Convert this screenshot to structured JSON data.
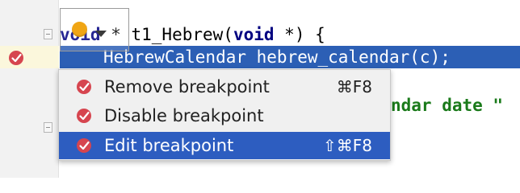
{
  "editor": {
    "line_1": {
      "keyword_void_1": "void",
      "text_mid": " * t1_Hebrew(",
      "keyword_void_2": "void",
      "text_end": " *) {"
    },
    "line_2": "HebrewCalendar hebrew_calendar(c);",
    "line_3": "ndar date \""
  },
  "context_menu": {
    "items": [
      {
        "label": "Remove breakpoint",
        "shortcut": "⌘F8",
        "icon": "breakpoint-icon",
        "selected": false
      },
      {
        "label": "Disable breakpoint",
        "shortcut": "",
        "icon": "breakpoint-icon",
        "selected": false
      },
      {
        "label": "Edit breakpoint",
        "shortcut": "⇧⌘F8",
        "icon": "breakpoint-icon",
        "selected": true
      }
    ]
  },
  "colors": {
    "selection_blue": "#2c5fb5",
    "breakpoint_red": "#d6454f",
    "widget_orange": "#f0a514",
    "string_green": "#1a7a1a"
  }
}
